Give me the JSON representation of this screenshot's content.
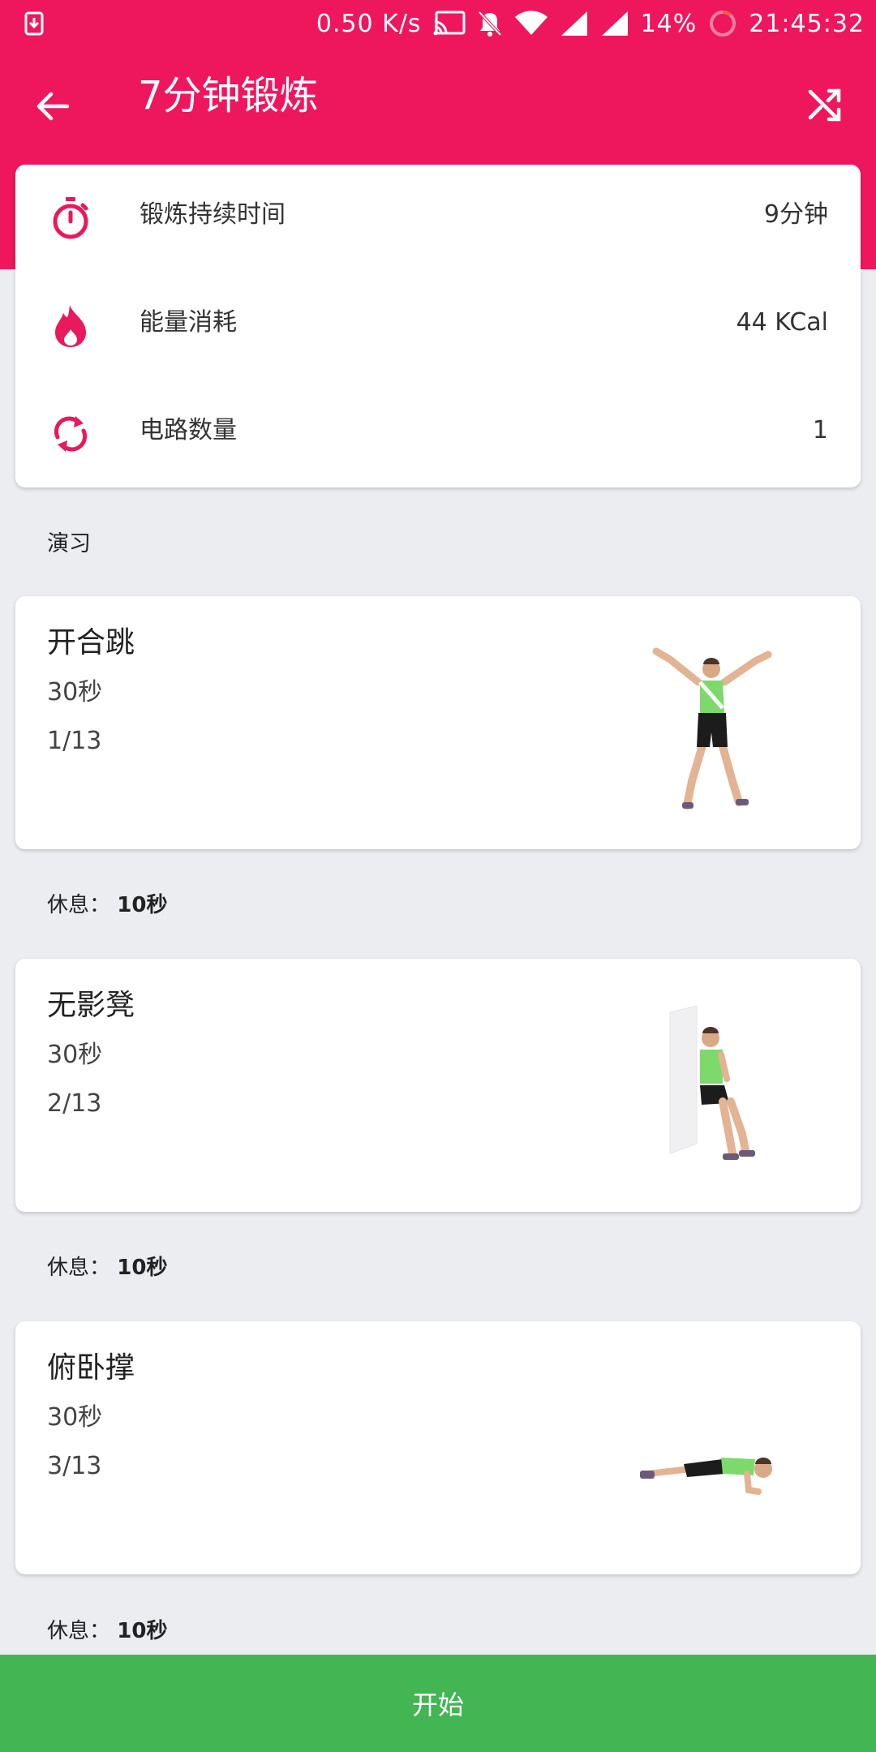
{
  "status_bar": {
    "speed": "0.50 K/s",
    "battery": "14%",
    "time": "21:45:32"
  },
  "toolbar": {
    "title": "7分钟锻炼",
    "back_icon": "arrow-back-icon",
    "shuffle_icon": "shuffle-icon"
  },
  "summary": {
    "rows": [
      {
        "icon": "timer-icon",
        "label": "锻炼持续时间",
        "value": "9分钟"
      },
      {
        "icon": "flame-icon",
        "label": "能量消耗",
        "value": "44 KCal"
      },
      {
        "icon": "repeat-icon",
        "label": "电路数量",
        "value": "1"
      }
    ]
  },
  "section_label": "演习",
  "exercises": [
    {
      "name": "开合跳",
      "duration": "30秒",
      "index": "1/13",
      "figure": "jumping-jacks-figure"
    },
    {
      "name": "无影凳",
      "duration": "30秒",
      "index": "2/13",
      "figure": "wall-sit-figure"
    },
    {
      "name": "俯卧撑",
      "duration": "30秒",
      "index": "3/13",
      "figure": "push-up-figure"
    }
  ],
  "rest": {
    "prefix": "休息：",
    "value": "10秒"
  },
  "start_button": "开始",
  "colors": {
    "primary": "#ee175e",
    "start_bar": "#41b653",
    "background": "#ecedf1"
  }
}
